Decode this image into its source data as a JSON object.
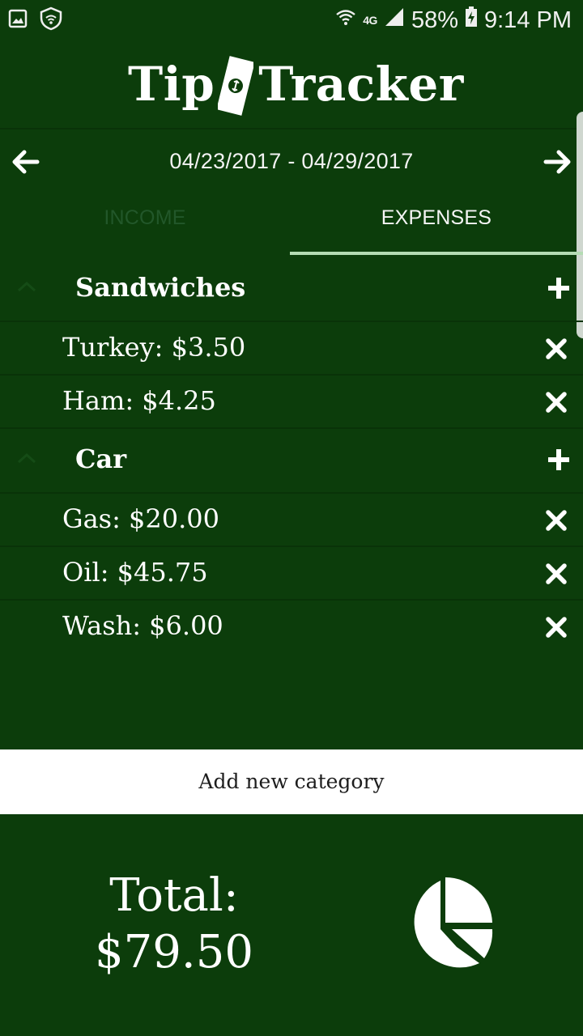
{
  "status_bar": {
    "network": "4G",
    "battery": "58%",
    "time": "9:14 PM",
    "icons": [
      "image-icon",
      "shield-wifi-icon",
      "wifi-calling-icon",
      "signal-icon",
      "battery-icon"
    ]
  },
  "app": {
    "title_left": "Tip",
    "title_right": "Tracker",
    "logo_icon": "dollar-bill-icon"
  },
  "date_nav": {
    "range": "04/23/2017 - 04/29/2017",
    "prev_icon": "arrow-left-icon",
    "next_icon": "arrow-right-icon"
  },
  "tabs": [
    {
      "label": "INCOME",
      "active": false
    },
    {
      "label": "EXPENSES",
      "active": true
    }
  ],
  "categories": [
    {
      "name": "Sandwiches",
      "items": [
        "Turkey: $3.50",
        "Ham: $4.25"
      ]
    },
    {
      "name": "Car",
      "items": [
        "Gas: $20.00",
        "Oil: $45.75",
        "Wash: $6.00"
      ]
    }
  ],
  "add_category_label": "Add new category",
  "total": {
    "label": "Total:",
    "amount": "$79.50",
    "chart_icon": "pie-chart-icon"
  },
  "colors": {
    "background": "#0c3d0b",
    "tab_indicator": "#b5dcb4",
    "inactive_tab": "#22572a",
    "text": "#ffffff"
  }
}
